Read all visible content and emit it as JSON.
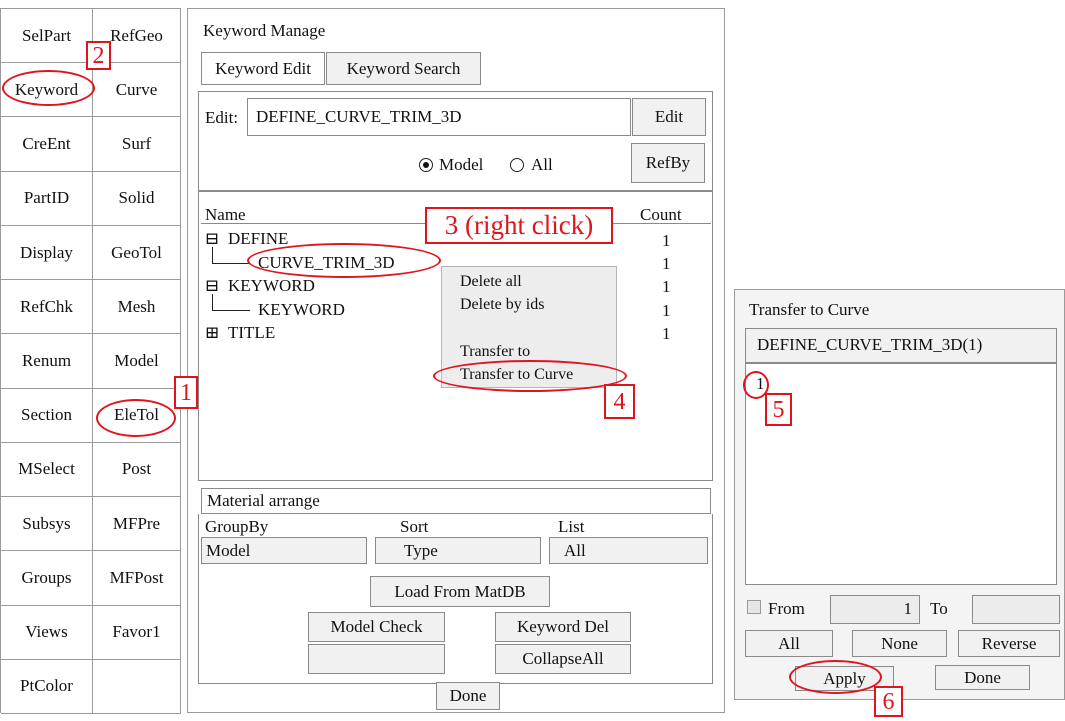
{
  "left_menu": {
    "col1": [
      "SelPart",
      "Keyword",
      "CreEnt",
      "PartID",
      "Display",
      "RefChk",
      "Renum",
      "Section",
      "MSelect",
      "Subsys",
      "Groups",
      "Views",
      "PtColor"
    ],
    "col2": [
      "RefGeo",
      "Curve",
      "Surf",
      "Solid",
      "GeoTol",
      "Mesh",
      "Model",
      "EleTol",
      "Post",
      "MFPre",
      "MFPost",
      "Favor1",
      ""
    ]
  },
  "keyword_manage": {
    "title": "Keyword Manage",
    "tabs": [
      "Keyword Edit",
      "Keyword Search"
    ],
    "edit_label": "Edit:",
    "edit_value": "DEFINE_CURVE_TRIM_3D",
    "edit_button": "Edit",
    "radio_model": "Model",
    "radio_all": "All",
    "refby_button": "RefBy",
    "col_name": "Name",
    "col_count": "Count",
    "tree": [
      {
        "icon": "⊟",
        "label": "DEFINE",
        "count": "1"
      },
      {
        "icon": "",
        "label": "CURVE_TRIM_3D",
        "count": "1"
      },
      {
        "icon": "⊟",
        "label": "KEYWORD",
        "count": "1"
      },
      {
        "icon": "",
        "label": "KEYWORD",
        "count": "1"
      },
      {
        "icon": "⊞",
        "label": "TITLE",
        "count": "1"
      }
    ],
    "context_menu": [
      "Delete all",
      "Delete by ids",
      "Transfer to",
      "Transfer to Curve"
    ],
    "material_arrange": "Material arrange",
    "groupby_label": "GroupBy",
    "sort_label": "Sort",
    "list_label": "List",
    "groupby_value": "Model",
    "sort_value": "Type",
    "list_value": "All",
    "load_button": "Load From MatDB",
    "model_check_button": "Model Check",
    "keyword_del_button": "Keyword Del",
    "collapse_button": "CollapseAll",
    "done_button": "Done"
  },
  "transfer": {
    "title": "Transfer to Curve",
    "header": "DEFINE_CURVE_TRIM_3D(1)",
    "items": [
      "1"
    ],
    "from_label": "From",
    "from_value": "1",
    "to_label": "To",
    "to_value": "",
    "all_button": "All",
    "none_button": "None",
    "reverse_button": "Reverse",
    "apply_button": "Apply",
    "done_button": "Done"
  },
  "annotations": {
    "step1": "1",
    "step2": "2",
    "step3": "3 (right click)",
    "step4": "4",
    "step5": "5",
    "step6": "6"
  },
  "colors": {
    "annotation": "#e0141c"
  }
}
